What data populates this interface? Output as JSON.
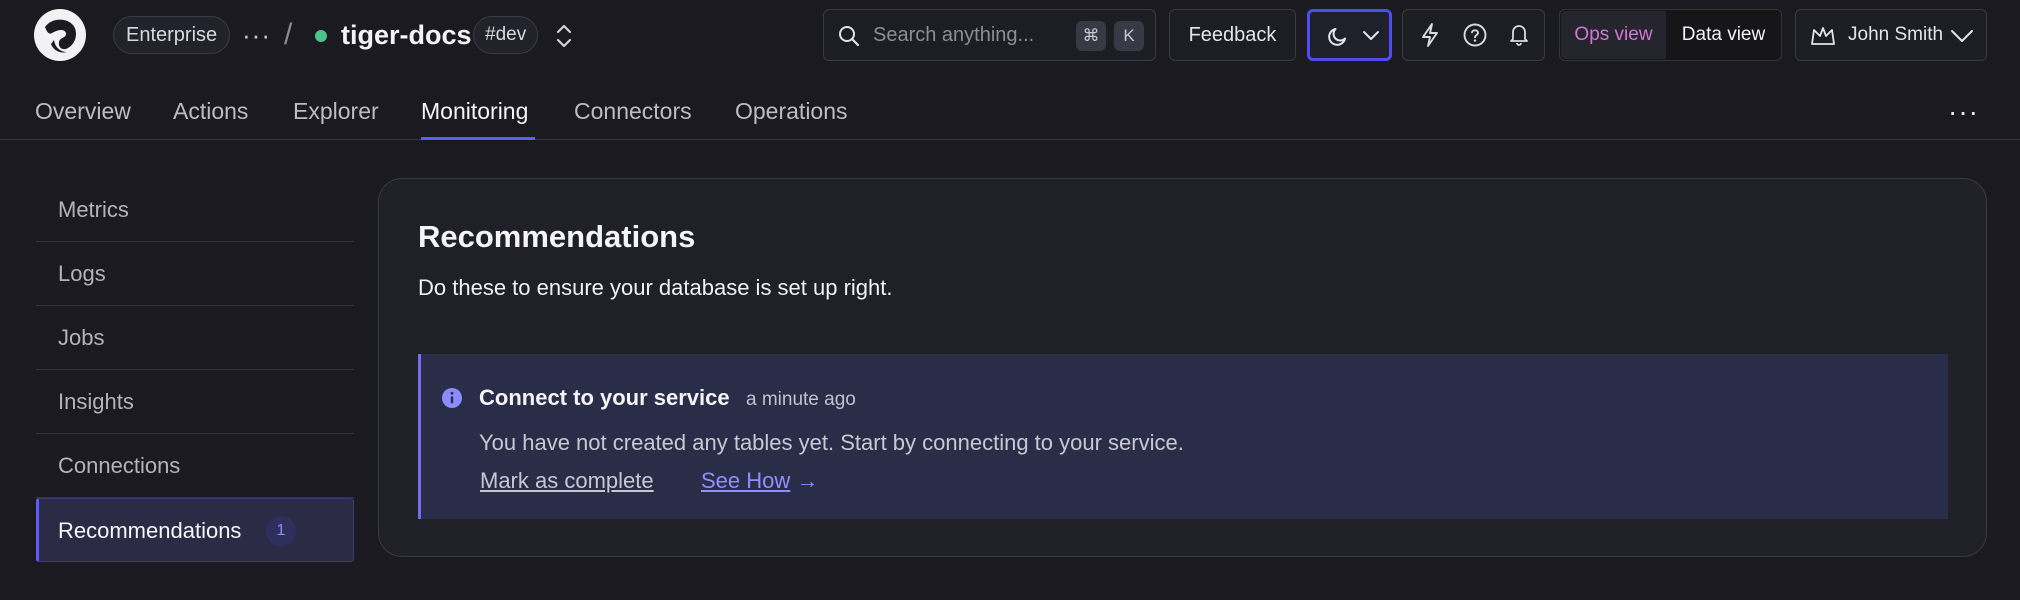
{
  "header": {
    "plan": "Enterprise",
    "project": "tiger-docs",
    "environment_tag": "#dev",
    "search": {
      "placeholder": "Search anything...",
      "shortcut_key_1": "⌘",
      "shortcut_key_2": "K"
    },
    "feedback_label": "Feedback",
    "view_toggle": {
      "ops_label": "Ops view",
      "data_label": "Data view"
    },
    "user": {
      "name": "John Smith"
    },
    "colors": {
      "status": "#4cc38a",
      "accent": "#5d5df5",
      "ops_view": "#d474d7"
    }
  },
  "tabs": [
    {
      "label": "Overview"
    },
    {
      "label": "Actions"
    },
    {
      "label": "Explorer"
    },
    {
      "label": "Monitoring",
      "active": true
    },
    {
      "label": "Connectors"
    },
    {
      "label": "Operations"
    }
  ],
  "sidebar": {
    "items": [
      {
        "label": "Metrics"
      },
      {
        "label": "Logs"
      },
      {
        "label": "Jobs"
      },
      {
        "label": "Insights"
      },
      {
        "label": "Connections"
      },
      {
        "label": "Recommendations",
        "active": true,
        "badge": "1"
      }
    ]
  },
  "recommendations": {
    "title": "Recommendations",
    "subtitle": "Do these to ensure your database is set up right.",
    "item": {
      "icon": "info-icon",
      "title": "Connect to your service",
      "time": "a minute ago",
      "message": "You have not created any tables yet. Start by connecting to your service.",
      "mark_complete_label": "Mark as complete",
      "see_how_label": "See How",
      "see_how_arrow": "→"
    }
  }
}
